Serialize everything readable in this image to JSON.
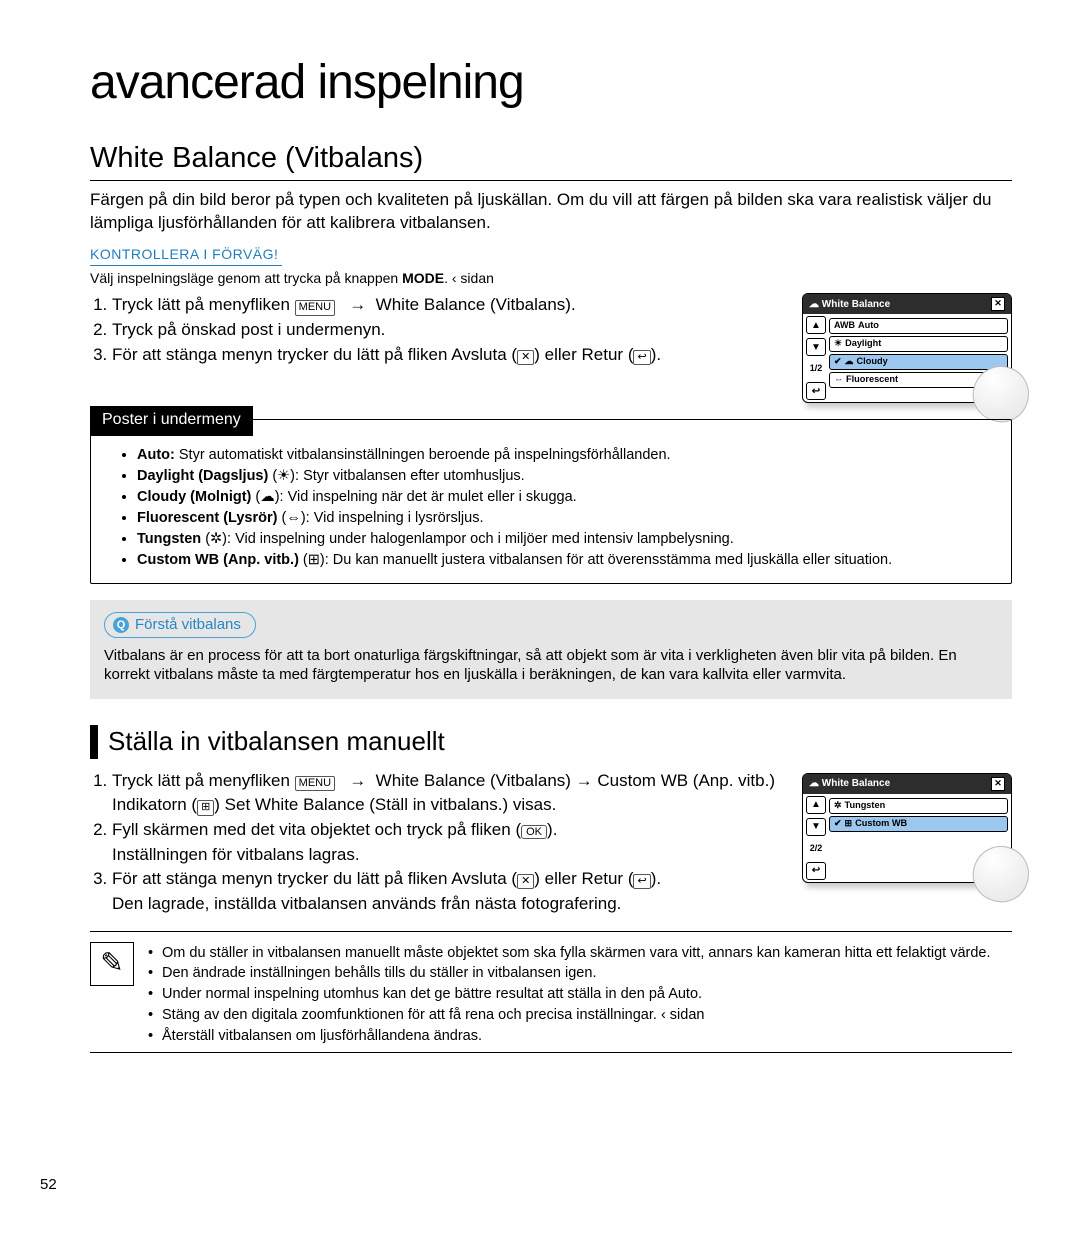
{
  "page_number": "52",
  "main_title": "avancerad inspelning",
  "section_title": "White Balance (Vitbalans)",
  "intro": "Färgen på din bild beror på typen och kvaliteten på ljuskällan. Om du vill att färgen på bilden ska vara realistisk väljer du lämpliga ljusförhållanden för att kalibrera vitbalansen.",
  "preflight_tag": "KONTROLLERA I FÖRVÄG!",
  "preflight_line_before": "Välj inspelningsläge genom att trycka på knappen ",
  "preflight_mode": "MODE",
  "preflight_line_after": ".               ‹ sidan",
  "proc1": {
    "s1a": "Tryck lätt på menyfliken ",
    "s1b": "White Balance (Vitbalans).",
    "s2": "Tryck på önskad post i undermenyn.",
    "s3a": "För att stänga menyn trycker du lätt på fliken Avsluta ",
    "s3b": " eller Retur "
  },
  "device1": {
    "title": "White Balance",
    "rows": [
      {
        "icon": "AWB",
        "label": "Auto"
      },
      {
        "icon": "☀",
        "label": "Daylight"
      },
      {
        "icon": "☁",
        "label": "Cloudy",
        "sel": true,
        "leading": "✔"
      },
      {
        "icon": "⇔",
        "label": "Fluorescent"
      }
    ],
    "side": [
      "▲",
      "▼",
      "1/2",
      "↩"
    ]
  },
  "submenu_label": "Poster i undermeny",
  "submenu_items": [
    {
      "b": "Auto:",
      "rest": " Styr automatiskt vitbalansinställningen beroende på inspelningsförhållanden."
    },
    {
      "b": "Daylight (Dagsljus)",
      "paren": " (☀): ",
      "rest": "Styr vitbalansen efter utomhusljus."
    },
    {
      "b": "Cloudy (Molnigt)",
      "paren": " (☁): ",
      "rest": "Vid inspelning när det är mulet eller i skugga."
    },
    {
      "b": "Fluorescent (Lysrör)",
      "paren": " (⇔): ",
      "rest": "Vid inspelning i lysrörsljus."
    },
    {
      "b": "Tungsten",
      "paren": " (✲): ",
      "rest": "Vid inspelning under halogenlampor och i miljöer med intensiv lampbelysning."
    },
    {
      "b": "Custom WB (Anp. vitb.)",
      "paren": " (⊞): ",
      "rest": "Du kan manuellt justera vitbalansen för att överensstämma med ljuskälla eller situation."
    }
  ],
  "tip_title": "Förstå vitbalans",
  "tip_body": "Vitbalans är en process för att ta bort onaturliga färgskiftningar, så att objekt som är vita i verkligheten även blir vita på bilden. En korrekt vitbalans måste ta med färgtemperatur hos en ljuskälla i beräkningen, de kan vara kallvita eller varmvita.",
  "manual_h": "Ställa in vitbalansen manuellt",
  "proc2": {
    "s1a": "Tryck lätt på menyfliken ",
    "s1b": "White Balance (Vitbalans) → Custom WB (Anp. vitb.)",
    "s1c": "Indikatorn ",
    "s1d": " Set White Balance (Ställ in vitbalans.) visas.",
    "s2a": "Fyll skärmen med det vita objektet och tryck på fliken ",
    "s2b": "Inställningen för vitbalans lagras.",
    "s3a": "För att stänga menyn trycker du lätt på fliken Avsluta ",
    "s3b": " eller Retur ",
    "s4": "Den lagrade, inställda vitbalansen används från nästa fotografering."
  },
  "device2": {
    "title": "White Balance",
    "rows": [
      {
        "icon": "✲",
        "label": "Tungsten"
      },
      {
        "icon": "⊞",
        "label": "Custom WB",
        "sel": true,
        "leading": "✔"
      }
    ],
    "side": [
      "▲",
      "▼",
      "2/2",
      "↩"
    ]
  },
  "notes": [
    "Om du ställer in vitbalansen manuellt måste objektet som ska fylla skärmen vara vitt, annars kan kameran hitta ett felaktigt värde.",
    "Den ändrade inställningen behålls tills du ställer in vitbalansen igen.",
    "Under normal inspelning utomhus kan det ge bättre resultat att ställa in den på             Auto.",
    "Stäng av den digitala zoomfunktionen för att få rena och precisa inställningar.                ‹ sidan",
    "Återställ vitbalansen om ljusförhållandena ändras."
  ],
  "glyph_menu": "MENU",
  "glyph_close": "✕",
  "glyph_return": "↩",
  "glyph_ok": "OK",
  "glyph_wb_set": "⊞"
}
